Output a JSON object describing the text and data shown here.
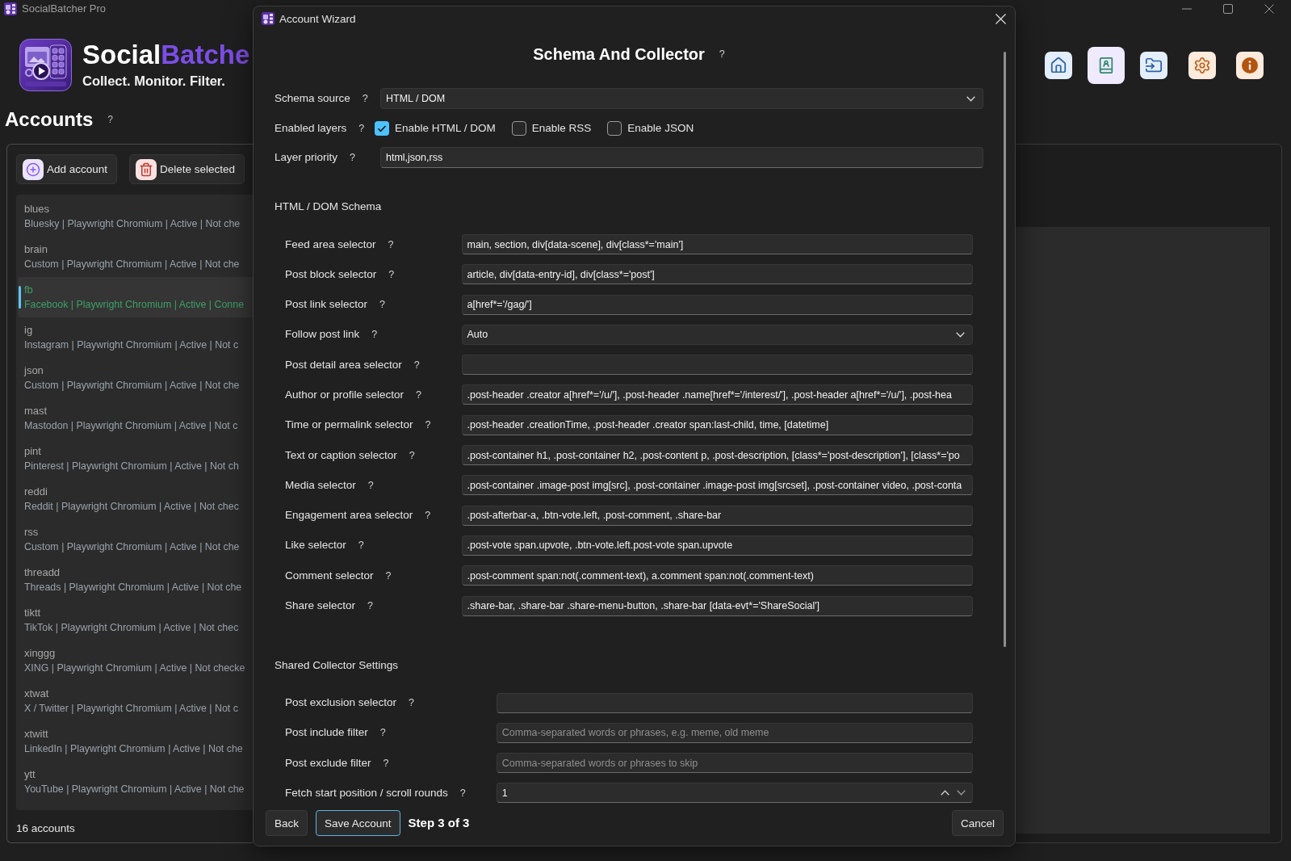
{
  "window": {
    "title": "SocialBatcher Pro"
  },
  "brand": {
    "name_start": "Social",
    "name_end": "Batche",
    "tagline": "Collect. Monitor. Filter."
  },
  "nav": [
    {
      "kind": "home",
      "selected": false
    },
    {
      "kind": "contacts",
      "selected": true
    },
    {
      "kind": "folder",
      "selected": false
    },
    {
      "kind": "settings",
      "selected": false
    },
    {
      "kind": "info",
      "selected": false
    }
  ],
  "accounts": {
    "title": "Accounts",
    "help": "?",
    "actions": [
      {
        "kind": "add",
        "label": "Add account"
      },
      {
        "kind": "delete",
        "label": "Delete selected"
      }
    ],
    "items": [
      {
        "name": "blues",
        "details": "Bluesky | Playwright Chromium | Active | Not che",
        "selected": false
      },
      {
        "name": "brain",
        "details": "Custom | Playwright Chromium | Active | Not che",
        "selected": false
      },
      {
        "name": "fb",
        "details": "Facebook | Playwright Chromium | Active | Conne",
        "selected": true
      },
      {
        "name": "ig",
        "details": "Instagram | Playwright Chromium | Active | Not c",
        "selected": false
      },
      {
        "name": "json",
        "details": "Custom | Playwright Chromium | Active | Not che",
        "selected": false
      },
      {
        "name": "mast",
        "details": "Mastodon | Playwright Chromium | Active | Not c",
        "selected": false
      },
      {
        "name": "pint",
        "details": "Pinterest | Playwright Chromium | Active | Not ch",
        "selected": false
      },
      {
        "name": "reddi",
        "details": "Reddit | Playwright Chromium | Active | Not chec",
        "selected": false
      },
      {
        "name": "rss",
        "details": "Custom | Playwright Chromium | Active | Not che",
        "selected": false
      },
      {
        "name": "threadd",
        "details": "Threads | Playwright Chromium | Active | Not che",
        "selected": false
      },
      {
        "name": "tiktt",
        "details": "TikTok | Playwright Chromium | Active | Not chec",
        "selected": false
      },
      {
        "name": "xinggg",
        "details": "XING | Playwright Chromium | Active | Not checke",
        "selected": false
      },
      {
        "name": "xtwat",
        "details": "X / Twitter | Playwright Chromium | Active | Not c",
        "selected": false
      },
      {
        "name": "xtwitt",
        "details": "LinkedIn | Playwright Chromium | Active | Not che",
        "selected": false
      },
      {
        "name": "ytt",
        "details": "YouTube | Playwright Chromium | Active | Not che",
        "selected": false
      }
    ],
    "count": "16 accounts"
  },
  "dialog": {
    "title": "Account Wizard",
    "heading": "Schema And Collector",
    "help": "?",
    "fields": [
      {
        "kind": "select",
        "label": "Schema source",
        "help": "?",
        "value": "HTML / DOM"
      },
      {
        "kind": "checkboxes",
        "label": "Enabled layers",
        "help": "?",
        "options": [
          {
            "label": "Enable HTML / DOM",
            "checked": true
          },
          {
            "label": "Enable RSS",
            "checked": false
          },
          {
            "label": "Enable JSON",
            "checked": false
          }
        ]
      },
      {
        "kind": "text",
        "label": "Layer priority",
        "help": "?",
        "value": "html,json,rss"
      }
    ],
    "sections": [
      {
        "title": "HTML / DOM Schema",
        "fields": [
          {
            "kind": "text",
            "label": "Feed area selector",
            "help": "?",
            "value": "main, section, div[data-scene], div[class*='main']"
          },
          {
            "kind": "text",
            "label": "Post block selector",
            "help": "?",
            "value": "article, div[data-entry-id], div[class*='post']"
          },
          {
            "kind": "text",
            "label": "Post link selector",
            "help": "?",
            "value": "a[href*='/gag/']"
          },
          {
            "kind": "select",
            "label": "Follow post link",
            "help": "?",
            "value": "Auto"
          },
          {
            "kind": "text",
            "label": "Post detail area selector",
            "help": "?"
          },
          {
            "kind": "text",
            "label": "Author or profile selector",
            "help": "?",
            "value": ".post-header .creator a[href*='/u/'], .post-header .name[href*='/interest/'], .post-header a[href*='/u/'], .post-hea"
          },
          {
            "kind": "text",
            "label": "Time or permalink selector",
            "help": "?",
            "value": ".post-header .creationTime, .post-header .creator span:last-child, time, [datetime]"
          },
          {
            "kind": "text",
            "label": "Text or caption selector",
            "help": "?",
            "value": ".post-container h1, .post-container h2, .post-content p, .post-description, [class*='post-description'], [class*='po"
          },
          {
            "kind": "text",
            "label": "Media selector",
            "help": "?",
            "value": ".post-container .image-post img[src], .post-container .image-post img[srcset], .post-container video, .post-conta"
          },
          {
            "kind": "text",
            "label": "Engagement area selector",
            "help": "?",
            "value": ".post-afterbar-a, .btn-vote.left, .post-comment, .share-bar"
          },
          {
            "kind": "text",
            "label": "Like selector",
            "help": "?",
            "value": ".post-vote span.upvote, .btn-vote.left.post-vote span.upvote"
          },
          {
            "kind": "text",
            "label": "Comment selector",
            "help": "?",
            "value": ".post-comment span:not(.comment-text), a.comment span:not(.comment-text)"
          },
          {
            "kind": "text",
            "label": "Share selector",
            "help": "?",
            "value": ".share-bar, .share-bar .share-menu-button, .share-bar [data-evt*='ShareSocial']"
          }
        ]
      },
      {
        "title": "Shared Collector Settings",
        "fields": [
          {
            "kind": "text",
            "label": "Post exclusion selector",
            "help": "?"
          },
          {
            "kind": "text",
            "label": "Post include filter",
            "help": "?",
            "placeholder": "Comma-separated words or phrases, e.g. meme, old meme"
          },
          {
            "kind": "text",
            "label": "Post exclude filter",
            "help": "?",
            "placeholder": "Comma-separated words or phrases to skip"
          },
          {
            "kind": "spin",
            "label": "Fetch start position / scroll rounds",
            "help": "?",
            "value": "1"
          }
        ]
      }
    ],
    "footer": {
      "buttons": [
        {
          "label": "Back",
          "focused": false
        },
        {
          "label": "Save Account",
          "focused": true
        }
      ],
      "step": "Step 3 of 3",
      "cancel": "Cancel"
    }
  }
}
